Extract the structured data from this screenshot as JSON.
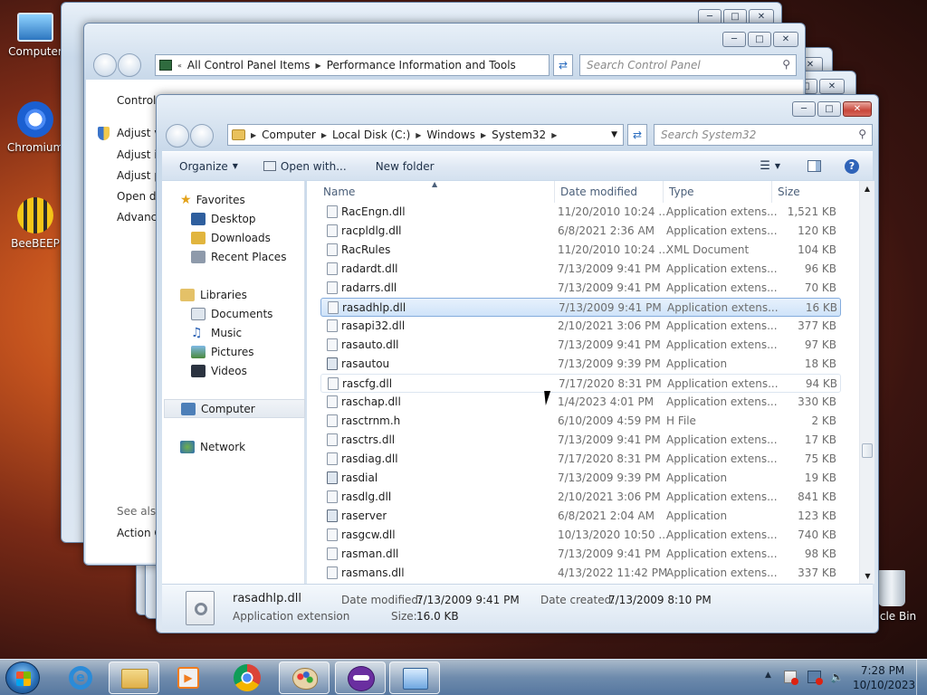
{
  "desktop": {
    "icons": [
      {
        "label": "Computer"
      },
      {
        "label": "Chromium"
      },
      {
        "label": "BeeBEEP"
      },
      {
        "label": "cle Bin"
      }
    ]
  },
  "bg_window": {
    "address": {
      "item1": "All Control Panel Items",
      "item2": "Performance Information and Tools"
    },
    "search_placeholder": "Search Control Panel",
    "sidebar": {
      "home": "Control",
      "links": [
        "Adjust v",
        "Adjust in",
        "Adjust p",
        "Open di",
        "Advance"
      ],
      "see_also": "See also",
      "action": "Action C"
    }
  },
  "explorer": {
    "address": {
      "computer": "Computer",
      "disk": "Local Disk (C:)",
      "windows": "Windows",
      "system32": "System32"
    },
    "search_placeholder": "Search System32",
    "toolbar": {
      "organize": "Organize",
      "open_with": "Open with...",
      "new_folder": "New folder"
    },
    "nav": {
      "favorites": "Favorites",
      "desktop": "Desktop",
      "downloads": "Downloads",
      "recent": "Recent Places",
      "libraries": "Libraries",
      "documents": "Documents",
      "music": "Music",
      "pictures": "Pictures",
      "videos": "Videos",
      "computer": "Computer",
      "network": "Network"
    },
    "columns": {
      "name": "Name",
      "date": "Date modified",
      "type": "Type",
      "size": "Size"
    },
    "files": [
      {
        "name": "RacEngn.dll",
        "date": "11/20/2010 10:24 ...",
        "type": "Application extens...",
        "size": "1,521 KB"
      },
      {
        "name": "racpldlg.dll",
        "date": "6/8/2021 2:36 AM",
        "type": "Application extens...",
        "size": "120 KB"
      },
      {
        "name": "RacRules",
        "date": "11/20/2010 10:24 ...",
        "type": "XML Document",
        "size": "104 KB"
      },
      {
        "name": "radardt.dll",
        "date": "7/13/2009 9:41 PM",
        "type": "Application extens...",
        "size": "96 KB"
      },
      {
        "name": "radarrs.dll",
        "date": "7/13/2009 9:41 PM",
        "type": "Application extens...",
        "size": "70 KB"
      },
      {
        "name": "rasadhlp.dll",
        "date": "7/13/2009 9:41 PM",
        "type": "Application extens...",
        "size": "16 KB"
      },
      {
        "name": "rasapi32.dll",
        "date": "2/10/2021 3:06 PM",
        "type": "Application extens...",
        "size": "377 KB"
      },
      {
        "name": "rasauto.dll",
        "date": "7/13/2009 9:41 PM",
        "type": "Application extens...",
        "size": "97 KB"
      },
      {
        "name": "rasautou",
        "date": "7/13/2009 9:39 PM",
        "type": "Application",
        "size": "18 KB"
      },
      {
        "name": "rascfg.dll",
        "date": "7/17/2020 8:31 PM",
        "type": "Application extens...",
        "size": "94 KB"
      },
      {
        "name": "raschap.dll",
        "date": "1/4/2023 4:01 PM",
        "type": "Application extens...",
        "size": "330 KB"
      },
      {
        "name": "rasctrnm.h",
        "date": "6/10/2009 4:59 PM",
        "type": "H File",
        "size": "2 KB"
      },
      {
        "name": "rasctrs.dll",
        "date": "7/13/2009 9:41 PM",
        "type": "Application extens...",
        "size": "17 KB"
      },
      {
        "name": "rasdiag.dll",
        "date": "7/17/2020 8:31 PM",
        "type": "Application extens...",
        "size": "75 KB"
      },
      {
        "name": "rasdial",
        "date": "7/13/2009 9:39 PM",
        "type": "Application",
        "size": "19 KB"
      },
      {
        "name": "rasdlg.dll",
        "date": "2/10/2021 3:06 PM",
        "type": "Application extens...",
        "size": "841 KB"
      },
      {
        "name": "raserver",
        "date": "6/8/2021 2:04 AM",
        "type": "Application",
        "size": "123 KB"
      },
      {
        "name": "rasgcw.dll",
        "date": "10/13/2020 10:50 ...",
        "type": "Application extens...",
        "size": "740 KB"
      },
      {
        "name": "rasman.dll",
        "date": "7/13/2009 9:41 PM",
        "type": "Application extens...",
        "size": "98 KB"
      },
      {
        "name": "rasmans.dll",
        "date": "4/13/2022 11:42 PM",
        "type": "Application extens...",
        "size": "337 KB"
      }
    ],
    "details": {
      "name": "rasadhlp.dll",
      "type": "Application extension",
      "modified_label": "Date modified:",
      "modified": "7/13/2009 9:41 PM",
      "created_label": "Date created:",
      "created": "7/13/2009 8:10 PM",
      "size_label": "Size:",
      "size": "16.0 KB"
    }
  },
  "taskbar": {
    "time": "7:28 PM",
    "date": "10/10/2023"
  },
  "colors": {
    "selection": "#cfe3f9",
    "accent": "#3a6ea5",
    "close": "#c9473a"
  }
}
